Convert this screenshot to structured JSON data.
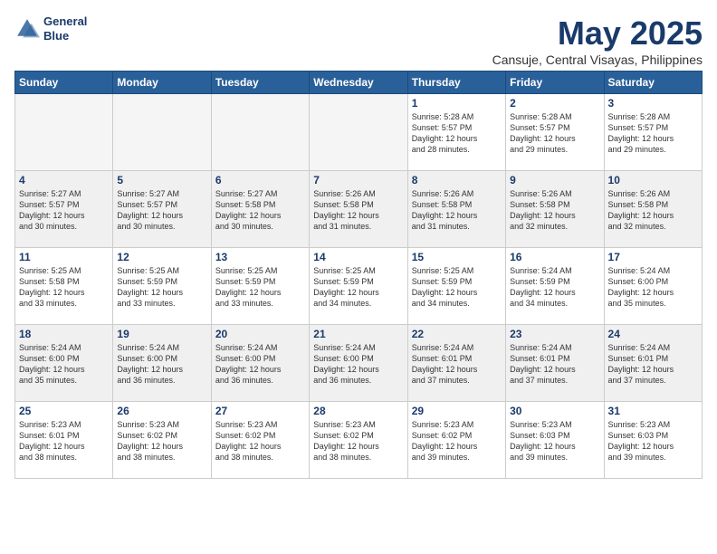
{
  "logo": {
    "line1": "General",
    "line2": "Blue"
  },
  "title": "May 2025",
  "subtitle": "Cansuje, Central Visayas, Philippines",
  "headers": [
    "Sunday",
    "Monday",
    "Tuesday",
    "Wednesday",
    "Thursday",
    "Friday",
    "Saturday"
  ],
  "weeks": [
    [
      {
        "day": "",
        "info": ""
      },
      {
        "day": "",
        "info": ""
      },
      {
        "day": "",
        "info": ""
      },
      {
        "day": "",
        "info": ""
      },
      {
        "day": "1",
        "info": "Sunrise: 5:28 AM\nSunset: 5:57 PM\nDaylight: 12 hours\nand 28 minutes."
      },
      {
        "day": "2",
        "info": "Sunrise: 5:28 AM\nSunset: 5:57 PM\nDaylight: 12 hours\nand 29 minutes."
      },
      {
        "day": "3",
        "info": "Sunrise: 5:28 AM\nSunset: 5:57 PM\nDaylight: 12 hours\nand 29 minutes."
      }
    ],
    [
      {
        "day": "4",
        "info": "Sunrise: 5:27 AM\nSunset: 5:57 PM\nDaylight: 12 hours\nand 30 minutes."
      },
      {
        "day": "5",
        "info": "Sunrise: 5:27 AM\nSunset: 5:57 PM\nDaylight: 12 hours\nand 30 minutes."
      },
      {
        "day": "6",
        "info": "Sunrise: 5:27 AM\nSunset: 5:58 PM\nDaylight: 12 hours\nand 30 minutes."
      },
      {
        "day": "7",
        "info": "Sunrise: 5:26 AM\nSunset: 5:58 PM\nDaylight: 12 hours\nand 31 minutes."
      },
      {
        "day": "8",
        "info": "Sunrise: 5:26 AM\nSunset: 5:58 PM\nDaylight: 12 hours\nand 31 minutes."
      },
      {
        "day": "9",
        "info": "Sunrise: 5:26 AM\nSunset: 5:58 PM\nDaylight: 12 hours\nand 32 minutes."
      },
      {
        "day": "10",
        "info": "Sunrise: 5:26 AM\nSunset: 5:58 PM\nDaylight: 12 hours\nand 32 minutes."
      }
    ],
    [
      {
        "day": "11",
        "info": "Sunrise: 5:25 AM\nSunset: 5:58 PM\nDaylight: 12 hours\nand 33 minutes."
      },
      {
        "day": "12",
        "info": "Sunrise: 5:25 AM\nSunset: 5:59 PM\nDaylight: 12 hours\nand 33 minutes."
      },
      {
        "day": "13",
        "info": "Sunrise: 5:25 AM\nSunset: 5:59 PM\nDaylight: 12 hours\nand 33 minutes."
      },
      {
        "day": "14",
        "info": "Sunrise: 5:25 AM\nSunset: 5:59 PM\nDaylight: 12 hours\nand 34 minutes."
      },
      {
        "day": "15",
        "info": "Sunrise: 5:25 AM\nSunset: 5:59 PM\nDaylight: 12 hours\nand 34 minutes."
      },
      {
        "day": "16",
        "info": "Sunrise: 5:24 AM\nSunset: 5:59 PM\nDaylight: 12 hours\nand 34 minutes."
      },
      {
        "day": "17",
        "info": "Sunrise: 5:24 AM\nSunset: 6:00 PM\nDaylight: 12 hours\nand 35 minutes."
      }
    ],
    [
      {
        "day": "18",
        "info": "Sunrise: 5:24 AM\nSunset: 6:00 PM\nDaylight: 12 hours\nand 35 minutes."
      },
      {
        "day": "19",
        "info": "Sunrise: 5:24 AM\nSunset: 6:00 PM\nDaylight: 12 hours\nand 36 minutes."
      },
      {
        "day": "20",
        "info": "Sunrise: 5:24 AM\nSunset: 6:00 PM\nDaylight: 12 hours\nand 36 minutes."
      },
      {
        "day": "21",
        "info": "Sunrise: 5:24 AM\nSunset: 6:00 PM\nDaylight: 12 hours\nand 36 minutes."
      },
      {
        "day": "22",
        "info": "Sunrise: 5:24 AM\nSunset: 6:01 PM\nDaylight: 12 hours\nand 37 minutes."
      },
      {
        "day": "23",
        "info": "Sunrise: 5:24 AM\nSunset: 6:01 PM\nDaylight: 12 hours\nand 37 minutes."
      },
      {
        "day": "24",
        "info": "Sunrise: 5:24 AM\nSunset: 6:01 PM\nDaylight: 12 hours\nand 37 minutes."
      }
    ],
    [
      {
        "day": "25",
        "info": "Sunrise: 5:23 AM\nSunset: 6:01 PM\nDaylight: 12 hours\nand 38 minutes."
      },
      {
        "day": "26",
        "info": "Sunrise: 5:23 AM\nSunset: 6:02 PM\nDaylight: 12 hours\nand 38 minutes."
      },
      {
        "day": "27",
        "info": "Sunrise: 5:23 AM\nSunset: 6:02 PM\nDaylight: 12 hours\nand 38 minutes."
      },
      {
        "day": "28",
        "info": "Sunrise: 5:23 AM\nSunset: 6:02 PM\nDaylight: 12 hours\nand 38 minutes."
      },
      {
        "day": "29",
        "info": "Sunrise: 5:23 AM\nSunset: 6:02 PM\nDaylight: 12 hours\nand 39 minutes."
      },
      {
        "day": "30",
        "info": "Sunrise: 5:23 AM\nSunset: 6:03 PM\nDaylight: 12 hours\nand 39 minutes."
      },
      {
        "day": "31",
        "info": "Sunrise: 5:23 AM\nSunset: 6:03 PM\nDaylight: 12 hours\nand 39 minutes."
      }
    ]
  ]
}
